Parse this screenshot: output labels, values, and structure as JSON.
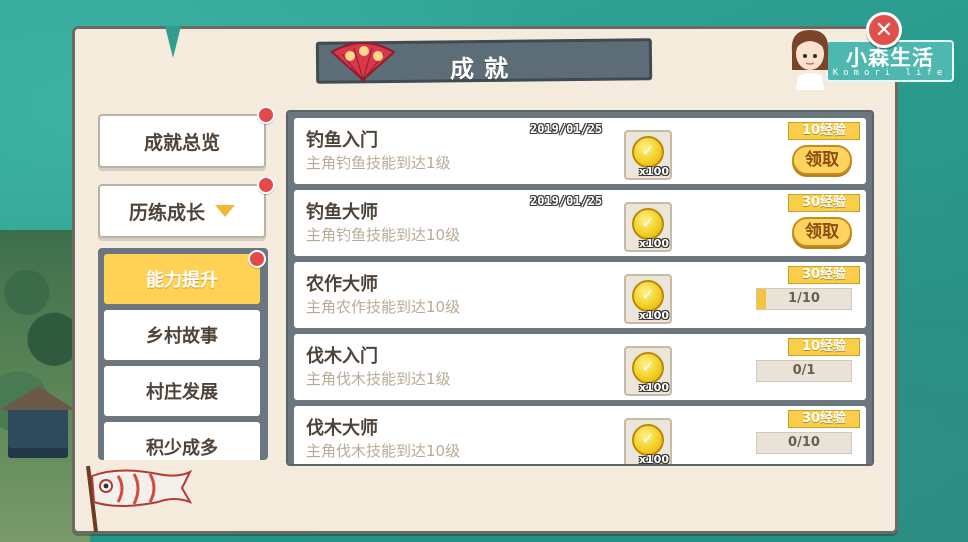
{
  "window": {
    "title": "成就",
    "close_icon": "close-x-icon"
  },
  "logo": {
    "title": "小森生活",
    "subtitle": "Komori life"
  },
  "sidebar": {
    "items": [
      {
        "label": "成就总览",
        "has_notification": true
      },
      {
        "label": "历练成长",
        "has_notification": true,
        "expanded": true
      }
    ],
    "sub_items": [
      {
        "label": "能力提升",
        "active": true,
        "has_notification": true
      },
      {
        "label": "乡村故事",
        "active": false
      },
      {
        "label": "村庄发展",
        "active": false
      },
      {
        "label": "积少成多",
        "active": false
      }
    ]
  },
  "achievements": [
    {
      "name": "钓鱼入门",
      "desc": "主角钓鱼技能到达1级",
      "date": "2019/01/25",
      "reward_qty": "x100",
      "exp": "10经验",
      "action": "领取"
    },
    {
      "name": "钓鱼大师",
      "desc": "主角钓鱼技能到达10级",
      "date": "2019/01/25",
      "reward_qty": "x100",
      "exp": "30经验",
      "action": "领取"
    },
    {
      "name": "农作大师",
      "desc": "主角农作技能到达10级",
      "reward_qty": "x100",
      "exp": "30经验",
      "progress": "1/10",
      "progress_fraction": 0.1
    },
    {
      "name": "伐木入门",
      "desc": "主角伐木技能到达1级",
      "reward_qty": "x100",
      "exp": "10经验",
      "progress": "0/1",
      "progress_fraction": 0
    },
    {
      "name": "伐木大师",
      "desc": "主角伐木技能到达10级",
      "reward_qty": "x100",
      "exp": "30经验",
      "progress": "0/10",
      "progress_fraction": 0
    }
  ],
  "colors": {
    "accent": "#ffd155",
    "notification": "#e44a4a",
    "panel": "#f4ebdd",
    "banner": "#5c6d78"
  }
}
